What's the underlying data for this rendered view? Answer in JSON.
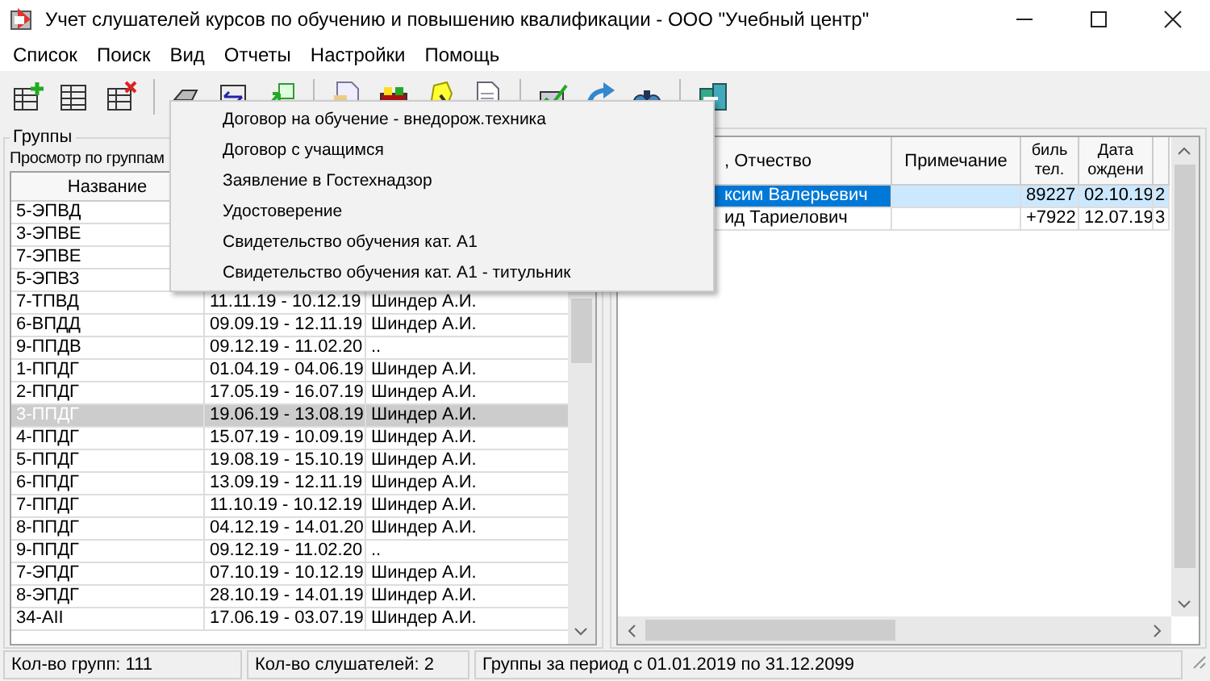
{
  "window": {
    "title": "Учет слушателей курсов по обучению и повышению квалификации - ООО \"Учебный центр\""
  },
  "menu": [
    "Список",
    "Поиск",
    "Вид",
    "Отчеты",
    "Настройки",
    "Помощь"
  ],
  "popup_menu": {
    "items": [
      "Договор на обучение - внедорож.техника",
      "Договор с учащимся",
      "Заявление в Гостехнадзор",
      "Удостоверение",
      "Свидетельство обучения кат. А1",
      "Свидетельство обучения кат. А1 - титульник"
    ]
  },
  "groups_panel": {
    "title": "Группы",
    "view_label": "Просмотр по группам",
    "table": {
      "columns": [
        "Название"
      ],
      "rows": [
        {
          "name": "5-ЭПВД",
          "selected": false
        },
        {
          "name": "3-ЭПВЕ",
          "selected": false
        },
        {
          "name": "7-ЭПВЕ",
          "selected": false
        },
        {
          "name": "5-ЭПВЗ",
          "selected": false
        },
        {
          "name": "7-ТПВД",
          "dates": "11.11.19 - 10.12.19",
          "teacher": "Шиндер А.И.",
          "selected": false
        },
        {
          "name": "6-ВПДД",
          "dates": "09.09.19 - 12.11.19",
          "teacher": "Шиндер А.И.",
          "selected": false
        },
        {
          "name": "9-ППДВ",
          "dates": "09.12.19 - 11.02.20",
          "teacher": "..",
          "selected": false
        },
        {
          "name": "1-ППДГ",
          "dates": "01.04.19 - 04.06.19",
          "teacher": "Шиндер А.И.",
          "selected": false
        },
        {
          "name": "2-ППДГ",
          "dates": "17.05.19 - 16.07.19",
          "teacher": "Шиндер А.И.",
          "selected": false
        },
        {
          "name": "3-ППДГ",
          "dates": "19.06.19 - 13.08.19",
          "teacher": "Шиндер А.И.",
          "selected": true
        },
        {
          "name": "4-ППДГ",
          "dates": "15.07.19 - 10.09.19",
          "teacher": "Шиндер А.И.",
          "selected": false
        },
        {
          "name": "5-ППДГ",
          "dates": "19.08.19 - 15.10.19",
          "teacher": "Шиндер А.И.",
          "selected": false
        },
        {
          "name": "6-ППДГ",
          "dates": "13.09.19 - 12.11.19",
          "teacher": "Шиндер А.И.",
          "selected": false
        },
        {
          "name": "7-ППДГ",
          "dates": "11.10.19 - 10.12.19",
          "teacher": "Шиндер А.И.",
          "selected": false
        },
        {
          "name": "8-ППДГ",
          "dates": "04.12.19 - 14.01.20",
          "teacher": "Шиндер А.И.",
          "selected": false
        },
        {
          "name": "9-ППДГ",
          "dates": "09.12.19 - 11.02.20",
          "teacher": "..",
          "selected": false
        },
        {
          "name": "7-ЭПДГ",
          "dates": "07.10.19 - 10.12.19",
          "teacher": "Шиндер А.И.",
          "selected": false
        },
        {
          "name": "8-ЭПДГ",
          "dates": "28.10.19 - 14.01.19",
          "teacher": "Шиндер А.И.",
          "selected": false
        },
        {
          "name": "34-AII",
          "dates": "17.06.19 - 03.07.19",
          "teacher": "Шиндер А.И.",
          "selected": false
        }
      ]
    }
  },
  "listeners_panel": {
    "table": {
      "columns": [
        ", Отчество",
        "Примечание",
        "биль тел.",
        "Дата ождени"
      ],
      "rows": [
        {
          "name": "ксим Валерьевич",
          "phone": "89227",
          "birth": "02.10.19",
          "extra": "2",
          "selected": true
        },
        {
          "name": "ид Тариелович",
          "phone": "+7922",
          "birth": "12.07.19",
          "extra": "3",
          "selected": false
        }
      ]
    }
  },
  "status_bar": [
    "Кол-во групп: 111",
    "Кол-во слушателей: 2",
    "Группы за период с 01.01.2019 по 31.12.2099"
  ]
}
